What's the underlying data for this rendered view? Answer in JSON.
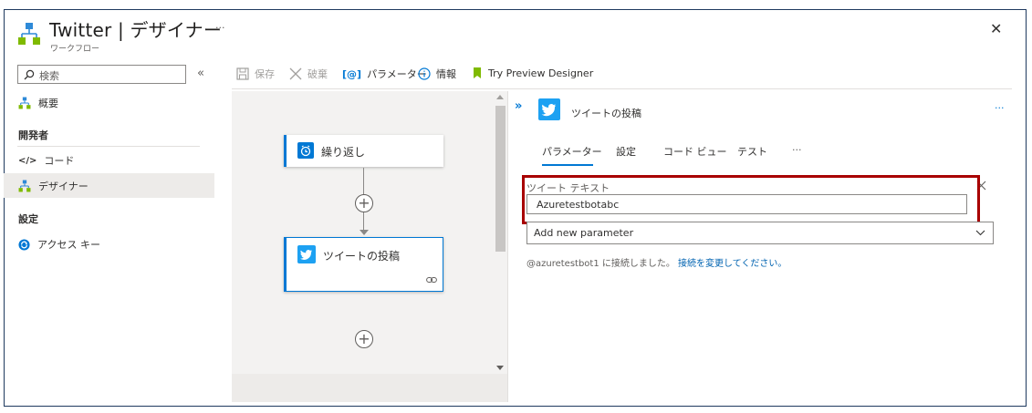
{
  "header": {
    "title": "Twitter | デザイナー",
    "subtitle": "ワークフロー",
    "more": "···",
    "close": "✕"
  },
  "sidebar": {
    "search_placeholder": "検索",
    "collapse": "«",
    "overview": "概要",
    "dev_section": "開発者",
    "code": "コード",
    "designer": "デザイナー",
    "settings_section": "設定",
    "access_key": "アクセス キー"
  },
  "toolbar": {
    "save": "保存",
    "discard": "破棄",
    "parameters": "パラメーター",
    "info": "情報",
    "preview": "Try Preview Designer"
  },
  "canvas": {
    "recurrence": "繰り返し",
    "tweet_post": "ツイートの投稿"
  },
  "panel": {
    "title": "ツイートの投稿",
    "more": "···",
    "tabs": [
      "パラメーター",
      "設定",
      "コード ビュー",
      "テスト",
      "···"
    ],
    "field_label": "ツイート テキスト",
    "field_value": "Azuretestbotabc",
    "add_param": "Add new parameter",
    "connection_text": "@azuretestbot1 に接続しました。",
    "connection_link": "接続を変更してください。"
  },
  "colors": {
    "accent": "#0078d4",
    "twitter": "#1da1f2",
    "highlight": "#a80000"
  }
}
